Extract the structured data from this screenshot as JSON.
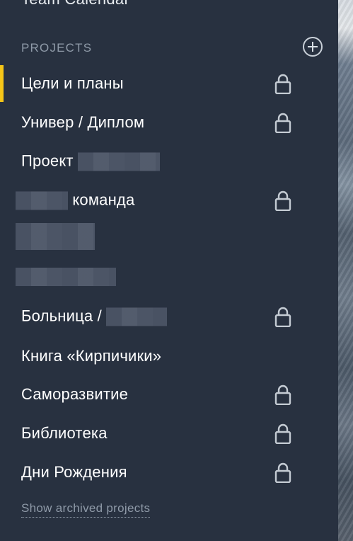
{
  "sidebar": {
    "team_calendar_label": "Team Calendar",
    "projects_header": "PROJECTS",
    "add_icon": "plus-circle-icon",
    "lock_icon": "lock-icon",
    "accent_color": "#f5c518",
    "projects": [
      {
        "label": "Цели и планы",
        "locked": true,
        "active": true
      },
      {
        "label": "Универ / Диплом",
        "locked": true
      },
      {
        "label": "Проект",
        "locked": false
      },
      {
        "label": "команда",
        "locked": true
      },
      {
        "label": "Больница /",
        "locked": true
      },
      {
        "label": "Книга «Кирпичики»",
        "locked": false
      },
      {
        "label": "Саморазвитие",
        "locked": true
      },
      {
        "label": "Библиотека",
        "locked": true
      },
      {
        "label": "Дни Рождения",
        "locked": true
      }
    ],
    "show_archived_label": "Show archived projects"
  }
}
